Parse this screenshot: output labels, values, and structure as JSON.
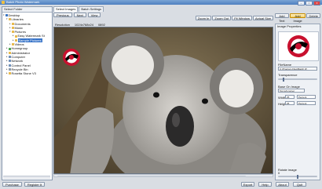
{
  "window": {
    "title": "Batch Photo Watermark"
  },
  "left_panel": {
    "header": "Select Folder",
    "tree": [
      {
        "label": "Desktop",
        "depth": 0,
        "color": "#3a76c4",
        "expanded": true
      },
      {
        "label": "Libraries",
        "depth": 1,
        "color": "#e8b94a",
        "expanded": true
      },
      {
        "label": "Documents",
        "depth": 2,
        "color": "#e8b94a"
      },
      {
        "label": "Music",
        "depth": 2,
        "color": "#e8b94a"
      },
      {
        "label": "Pictures",
        "depth": 2,
        "color": "#e8b94a",
        "expanded": true
      },
      {
        "label": "Easy Watermark St",
        "depth": 3,
        "color": "#e8b94a"
      },
      {
        "label": "Sample Pictures",
        "depth": 3,
        "color": "#e8b94a",
        "selected": true
      },
      {
        "label": "Videos",
        "depth": 2,
        "color": "#e8b94a"
      },
      {
        "label": "Homegroup",
        "depth": 1,
        "color": "#4aa34f"
      },
      {
        "label": "Administrator",
        "depth": 1,
        "color": "#e8b94a"
      },
      {
        "label": "Computer",
        "depth": 1,
        "color": "#6f8fb8"
      },
      {
        "label": "Network",
        "depth": 1,
        "color": "#6f8fb8"
      },
      {
        "label": "Control Panel",
        "depth": 1,
        "color": "#6f8fb8"
      },
      {
        "label": "Recycle Bin",
        "depth": 1,
        "color": "#8a99aa"
      },
      {
        "label": "Rosetta Stone V3",
        "depth": 1,
        "color": "#e8b94a"
      }
    ]
  },
  "bottom_left": {
    "purchase": "Purchase",
    "register": "Register It"
  },
  "main": {
    "tabs": [
      "Select Images",
      "Batch Settings"
    ],
    "toolbar": {
      "previous": "Previous",
      "next": "Next",
      "view": "View"
    },
    "zoom": {
      "zoom_in": "Zoom In",
      "zoom_out": "Zoom Out",
      "fit": "Fit Window",
      "actual": "Actual Size"
    },
    "info": {
      "resolution_label": "Resolution",
      "resolution_value": "1024x768x24",
      "size_value": "0892"
    }
  },
  "right_panel": {
    "add_text": "Add Text",
    "add_image": "Add Image",
    "delete": "Delete",
    "properties_header": "Image Properties",
    "filename_label": "FileName",
    "filename_value": "C:\\Program Files\\Batch W",
    "transparence_label": "Transparence",
    "transparence_value": 0.12,
    "size_label": "Base On Image",
    "size_value": "Top left corner",
    "width_label": "Width",
    "width_value": "25",
    "width_unit": "Percent",
    "height_label": "Height",
    "height_value": "25",
    "height_unit": "Percent",
    "rotate_label": "Rotate image",
    "rotate_value": "0",
    "rotate_level": 0.5
  },
  "bottom_right": {
    "export": "Export",
    "help": "Help",
    "about": "About",
    "quit": "Quit"
  },
  "colors": {
    "accent": "#3874c8",
    "logo_red": "#c8102e",
    "highlight": "#f2cf6b"
  }
}
